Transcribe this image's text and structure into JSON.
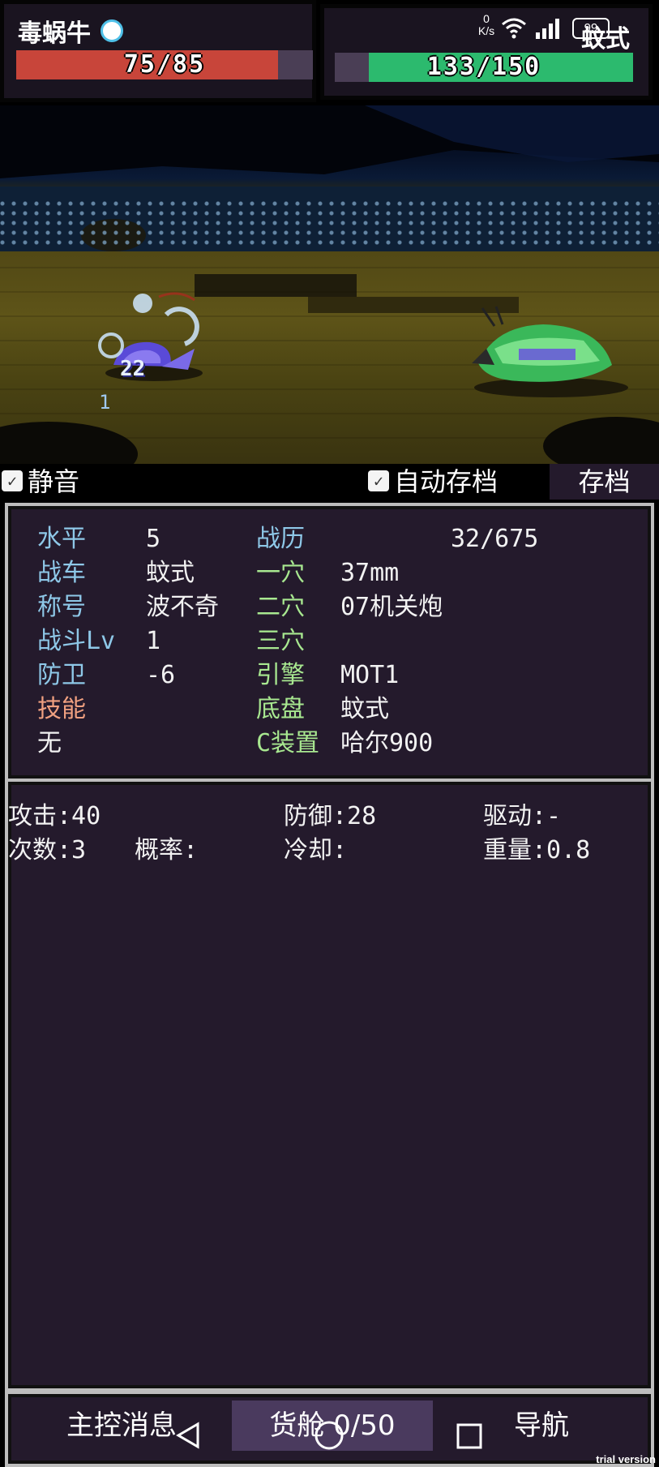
{
  "player": {
    "name": "毒蜗牛",
    "hp_text": "75/85",
    "hp_fraction": 0.8824
  },
  "enemy": {
    "name": "蚊式",
    "hp_text": "133/150",
    "hp_fraction": 0.8867
  },
  "status_bar": {
    "net_speed_value": "0",
    "net_speed_unit": "K/s",
    "battery": "99"
  },
  "scene": {
    "damage_number": "22",
    "hit_number": "1"
  },
  "options": {
    "mute_label": "静音",
    "mute_checked": true,
    "autosave_label": "自动存档",
    "autosave_checked": true,
    "save_button": "存档"
  },
  "stats": {
    "level": {
      "label": "水平",
      "value": "5"
    },
    "tank": {
      "label": "战车",
      "value": "蚊式"
    },
    "title": {
      "label": "称号",
      "value": "波不奇"
    },
    "battle_lv": {
      "label": "战斗Lv",
      "value": "1"
    },
    "defense": {
      "label": "防卫",
      "value": "-6"
    },
    "skill": {
      "label": "技能",
      "value": "无"
    },
    "battle_record": {
      "label": "战历",
      "value": "32/675"
    },
    "slot1": {
      "label": "一穴",
      "value": "37mm"
    },
    "slot2": {
      "label": "二穴",
      "value": "07机关炮"
    },
    "slot3": {
      "label": "三穴",
      "value": ""
    },
    "engine": {
      "label": "引擎",
      "value": "MOT1"
    },
    "chassis": {
      "label": "底盘",
      "value": "蚊式"
    },
    "c_device": {
      "label": "C装置",
      "value": "哈尔900"
    }
  },
  "details": {
    "attack": "攻击:40",
    "defense": "防御:28",
    "drive": "驱动:-",
    "count": "次数:3",
    "probability": "概率:",
    "cooldown": "冷却:",
    "weight": "重量:0.8"
  },
  "nav": {
    "main_msg": "主控消息",
    "cargo": "货舱 0/50",
    "navigation": "导航"
  },
  "watermark": "trial version",
  "colors": {
    "hp_red": "#c8453a",
    "hp_green": "#2cba6e",
    "panel_bg": "#241a2c",
    "label_blue": "#8ec8e8",
    "label_green": "#a8e890",
    "label_orange": "#f0a080"
  }
}
